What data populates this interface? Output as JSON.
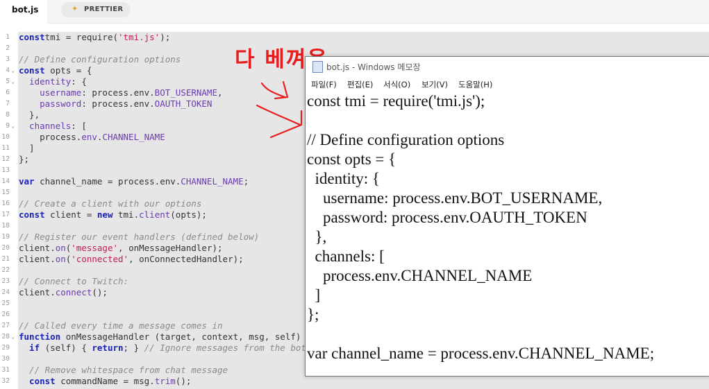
{
  "tabs": {
    "active": "bot.js",
    "prettier_label": "PRETTIER",
    "prettier_icon": "sparkle-icon"
  },
  "annotation": "다 베껴옴",
  "code_lines": [
    {
      "n": "1",
      "fold": "",
      "segs": [
        [
          "kw",
          "const"
        ],
        [
          "",
          "tmi = require("
        ],
        [
          "st",
          "'tmi.js'"
        ],
        [
          "",
          ");"
        ]
      ]
    },
    {
      "n": "2",
      "fold": "",
      "segs": []
    },
    {
      "n": "3",
      "fold": "",
      "segs": [
        [
          "cm",
          "// Define configuration options"
        ]
      ]
    },
    {
      "n": "4",
      "fold": "⌄",
      "segs": [
        [
          "kw",
          "const"
        ],
        [
          "",
          " opts = {"
        ]
      ]
    },
    {
      "n": "5",
      "fold": "⌄",
      "segs": [
        [
          "pr",
          "  identity"
        ],
        [
          "",
          ": {"
        ]
      ]
    },
    {
      "n": "6",
      "fold": "",
      "segs": [
        [
          "pr",
          "    username"
        ],
        [
          "",
          ": process.env."
        ],
        [
          "pr",
          "BOT_USERNAME"
        ],
        [
          "",
          ","
        ]
      ]
    },
    {
      "n": "7",
      "fold": "",
      "segs": [
        [
          "pr",
          "    password"
        ],
        [
          "",
          ": process.env."
        ],
        [
          "pr",
          "OAUTH_TOKEN"
        ]
      ]
    },
    {
      "n": "8",
      "fold": "",
      "segs": [
        [
          "",
          "  },"
        ]
      ]
    },
    {
      "n": "9",
      "fold": "⌄",
      "segs": [
        [
          "pr",
          "  channels"
        ],
        [
          "",
          ": ["
        ]
      ]
    },
    {
      "n": "10",
      "fold": "",
      "segs": [
        [
          "",
          "    process."
        ],
        [
          "pr",
          "env"
        ],
        [
          "",
          "."
        ],
        [
          "pr",
          "CHANNEL_NAME"
        ]
      ]
    },
    {
      "n": "11",
      "fold": "",
      "segs": [
        [
          "",
          "  ]"
        ]
      ]
    },
    {
      "n": "12",
      "fold": "",
      "segs": [
        [
          "",
          "};"
        ]
      ]
    },
    {
      "n": "13",
      "fold": "",
      "segs": []
    },
    {
      "n": "14",
      "fold": "",
      "segs": [
        [
          "kw",
          "var"
        ],
        [
          "",
          " channel_name = process.env."
        ],
        [
          "pr",
          "CHANNEL_NAME"
        ],
        [
          "",
          ";"
        ]
      ]
    },
    {
      "n": "15",
      "fold": "",
      "segs": []
    },
    {
      "n": "16",
      "fold": "",
      "segs": [
        [
          "cm",
          "// Create a client with our options"
        ]
      ]
    },
    {
      "n": "17",
      "fold": "",
      "segs": [
        [
          "kw",
          "const"
        ],
        [
          "",
          " client = "
        ],
        [
          "kw",
          "new"
        ],
        [
          "",
          " tmi."
        ],
        [
          "pr",
          "client"
        ],
        [
          "",
          "(opts);"
        ]
      ]
    },
    {
      "n": "18",
      "fold": "",
      "segs": []
    },
    {
      "n": "19",
      "fold": "",
      "segs": [
        [
          "cm",
          "// Register our event handlers (defined below)"
        ]
      ]
    },
    {
      "n": "20",
      "fold": "",
      "segs": [
        [
          "",
          "client."
        ],
        [
          "pr",
          "on"
        ],
        [
          "",
          "("
        ],
        [
          "st",
          "'message'"
        ],
        [
          "",
          ", onMessageHandler);"
        ]
      ]
    },
    {
      "n": "21",
      "fold": "",
      "segs": [
        [
          "",
          "client."
        ],
        [
          "pr",
          "on"
        ],
        [
          "",
          "("
        ],
        [
          "st",
          "'connected'"
        ],
        [
          "",
          ", onConnectedHandler);"
        ]
      ]
    },
    {
      "n": "22",
      "fold": "",
      "segs": []
    },
    {
      "n": "23",
      "fold": "",
      "segs": [
        [
          "cm",
          "// Connect to Twitch:"
        ]
      ]
    },
    {
      "n": "24",
      "fold": "",
      "segs": [
        [
          "",
          "client."
        ],
        [
          "pr",
          "connect"
        ],
        [
          "",
          "();"
        ]
      ]
    },
    {
      "n": "25",
      "fold": "",
      "segs": []
    },
    {
      "n": "26",
      "fold": "",
      "segs": []
    },
    {
      "n": "27",
      "fold": "",
      "segs": [
        [
          "cm",
          "// Called every time a message comes in"
        ]
      ]
    },
    {
      "n": "28",
      "fold": "⌄",
      "segs": [
        [
          "kw",
          "function"
        ],
        [
          "",
          " onMessageHandler (target, context, msg, self) {"
        ]
      ]
    },
    {
      "n": "29",
      "fold": "",
      "segs": [
        [
          "kw",
          "  if"
        ],
        [
          "",
          " (self) { "
        ],
        [
          "kw",
          "return"
        ],
        [
          "",
          "; } "
        ],
        [
          "cm",
          "// Ignore messages from the bot"
        ]
      ]
    },
    {
      "n": "30",
      "fold": "",
      "segs": []
    },
    {
      "n": "31",
      "fold": "",
      "segs": [
        [
          "cm",
          "  // Remove whitespace from chat message"
        ]
      ]
    },
    {
      "n": "32",
      "fold": "",
      "segs": [
        [
          "kw",
          "  const"
        ],
        [
          "",
          " commandName = msg."
        ],
        [
          "pr",
          "trim"
        ],
        [
          "",
          "();"
        ]
      ]
    }
  ],
  "notepad": {
    "title": "bot.js - Windows 메모장",
    "menu": [
      "파일(F)",
      "편집(E)",
      "서식(O)",
      "보기(V)",
      "도움말(H)"
    ],
    "lines": [
      "const tmi = require('tmi.js');",
      "",
      "// Define configuration options",
      "const opts = {",
      "  identity: {",
      "    username: process.env.BOT_USERNAME,",
      "    password: process.env.OAUTH_TOKEN",
      "  },",
      "  channels: [",
      "    process.env.CHANNEL_NAME",
      "  ]",
      "};",
      "",
      "var channel_name = process.env.CHANNEL_NAME;"
    ]
  }
}
